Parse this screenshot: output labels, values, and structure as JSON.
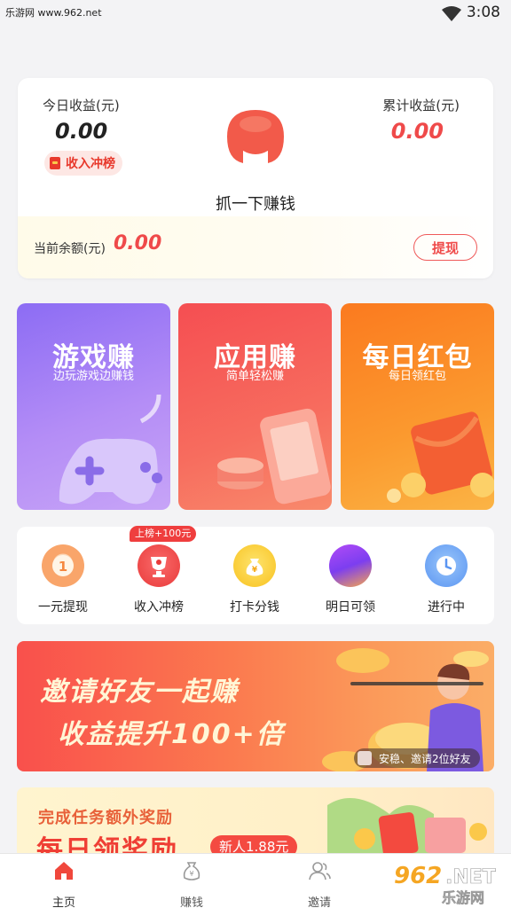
{
  "status": {
    "watermark": "乐游网 www.962.net",
    "time": "3:08"
  },
  "earnings": {
    "today_label": "今日收益(元)",
    "today_value": "0.00",
    "rank_label": "收入冲榜",
    "total_label": "累计收益(元)",
    "total_value": "0.00",
    "grab_text": "抓一下赚钱",
    "balance_label": "当前余额(元)",
    "balance_value": "0.00",
    "withdraw_label": "提现"
  },
  "features": [
    {
      "title": "游戏赚",
      "subtitle": "边玩游戏边赚钱",
      "icon": "gamepad-icon"
    },
    {
      "title": "应用赚",
      "subtitle": "简单轻松赚",
      "icon": "phone-coins-icon"
    },
    {
      "title": "每日红包",
      "subtitle": "每日领红包",
      "icon": "red-envelope-icon"
    }
  ],
  "quick_actions": {
    "rank_tag": "上榜+100元",
    "items": [
      {
        "label": "一元提现",
        "icon": "coin-one-icon"
      },
      {
        "label": "收入冲榜",
        "icon": "trophy-icon"
      },
      {
        "label": "打卡分钱",
        "icon": "money-bag-icon"
      },
      {
        "label": "明日可领",
        "icon": "purple-orb-icon"
      },
      {
        "label": "进行中",
        "icon": "clock-icon"
      }
    ]
  },
  "invite_banner": {
    "line1": "邀请好友一起赚",
    "line2": "收益提升100+倍",
    "pill_text": "安稳、邀请2位好友"
  },
  "reward_banner": {
    "line1": "完成任务额外奖励",
    "line2": "每日领奖励",
    "tag": "新人1.88元"
  },
  "tabs": [
    {
      "label": "主页",
      "icon": "home-icon",
      "active": true
    },
    {
      "label": "赚钱",
      "icon": "money-bag-icon",
      "active": false
    },
    {
      "label": "邀请",
      "icon": "users-icon",
      "active": false
    }
  ],
  "brand_watermark": "962.NET 乐游网",
  "colors": {
    "accent": "#ef4a4a",
    "purple": "#8c6cf4",
    "orange": "#fb8a2a"
  }
}
